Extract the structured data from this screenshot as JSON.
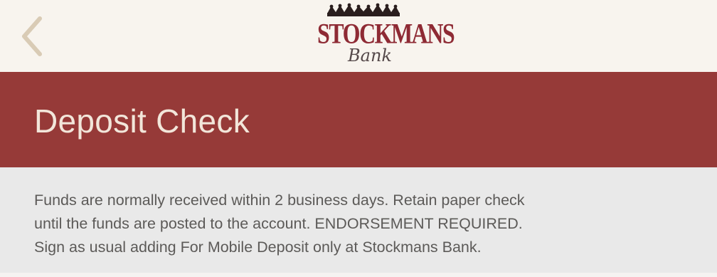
{
  "header": {
    "back_icon": "chevron-left-icon",
    "logo": {
      "wordmark": "STOCKMANS",
      "script": "Bank"
    }
  },
  "title_bar": {
    "title": "Deposit Check"
  },
  "info": {
    "lines": [
      "Funds are normally received within 2 business days. Retain paper check",
      "until the funds are posted to the account. ENDORSEMENT REQUIRED.",
      "Sign as usual adding For Mobile Deposit only at Stockmans Bank."
    ]
  },
  "colors": {
    "nav_background": "#f8f4ee",
    "title_background": "#963a38",
    "title_text": "#f2e6da",
    "info_background": "#e9e9e9",
    "info_text": "#5c5a58",
    "brand_red": "#8e2a34",
    "back_chevron": "#d9cbb5"
  }
}
